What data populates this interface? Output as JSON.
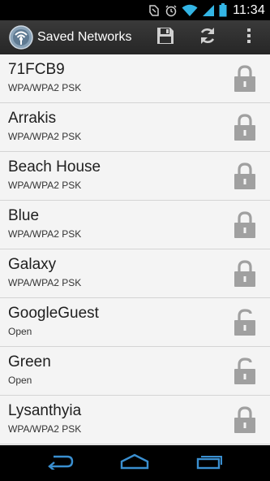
{
  "status": {
    "time": "11:34",
    "icons": [
      "unknown-notification-icon",
      "alarm-icon",
      "wifi-icon",
      "signal-icon",
      "battery-icon"
    ]
  },
  "actionbar": {
    "title": "Saved Networks",
    "actions": [
      "save-icon",
      "refresh-icon",
      "overflow-menu-icon"
    ]
  },
  "networks": [
    {
      "ssid": "71FCB9",
      "security": "WPA/WPA2 PSK",
      "locked": true
    },
    {
      "ssid": "Arrakis",
      "security": "WPA/WPA2 PSK",
      "locked": true
    },
    {
      "ssid": "Beach House",
      "security": "WPA/WPA2 PSK",
      "locked": true
    },
    {
      "ssid": "Blue",
      "security": "WPA/WPA2 PSK",
      "locked": true
    },
    {
      "ssid": "Galaxy",
      "security": "WPA/WPA2 PSK",
      "locked": true
    },
    {
      "ssid": "GoogleGuest",
      "security": "Open",
      "locked": false
    },
    {
      "ssid": "Green",
      "security": "Open",
      "locked": false
    },
    {
      "ssid": "Lysanthyia",
      "security": "WPA/WPA2 PSK",
      "locked": true
    }
  ],
  "navbar": [
    "back-icon",
    "home-icon",
    "recent-apps-icon"
  ],
  "colors": {
    "status_accent": "#33b5e5",
    "actionbar": "#2f2f2f",
    "list_bg": "#f4f4f4",
    "lock_icon": "#a0a0a0"
  }
}
